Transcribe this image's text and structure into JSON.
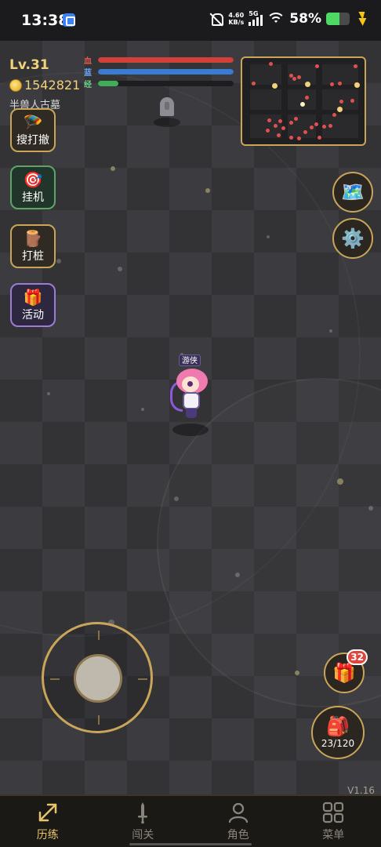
{
  "status_bar": {
    "time": "13:38",
    "speed_value": "4.60",
    "speed_unit": "KB/s",
    "network": "5G",
    "battery_percent": "58%",
    "battery_level": 0.58,
    "charging": true
  },
  "hud": {
    "level": "Lv.31",
    "gold": "1542821",
    "map_name": "半兽人古墓",
    "bars": [
      {
        "label": "血",
        "fill": 1.0,
        "color": "#d2403a",
        "label_color": "#e05a50"
      },
      {
        "label": "蓝",
        "fill": 1.0,
        "color": "#3a7cd2",
        "label_color": "#6aa4f0"
      },
      {
        "label": "经",
        "fill": 0.15,
        "color": "#3fae5a",
        "label_color": "#6fd08a"
      }
    ]
  },
  "minimap": {
    "enemies": 30,
    "chests": 4
  },
  "side_buttons": [
    {
      "label": "搜打撤",
      "icon": "parachute-icon",
      "glyph": "🪂"
    },
    {
      "label": "挂机",
      "icon": "target-icon",
      "glyph": "🎯"
    },
    {
      "label": "打桩",
      "icon": "training-stump-icon",
      "glyph": "🪵"
    },
    {
      "label": "活动",
      "icon": "gift-icon",
      "glyph": "🎁"
    }
  ],
  "right_buttons": {
    "map_glyph": "🗺️",
    "settings_glyph": "⚙️"
  },
  "hero": {
    "class_tag": "游侠"
  },
  "gift": {
    "glyph": "🎁",
    "badge": "32"
  },
  "bag": {
    "glyph": "🎒",
    "capacity": "23/120"
  },
  "version": "V1.16",
  "nav": [
    {
      "label": "历练",
      "icon": "expand-arrows-icon",
      "active": true
    },
    {
      "label": "闯关",
      "icon": "sword-icon",
      "active": false
    },
    {
      "label": "角色",
      "icon": "person-icon",
      "active": false
    },
    {
      "label": "菜单",
      "icon": "grid-icon",
      "active": false
    }
  ],
  "colors": {
    "accent_gold": "#c9a55a",
    "text_gold": "#f1d27a",
    "badge_red": "#e0453e"
  }
}
